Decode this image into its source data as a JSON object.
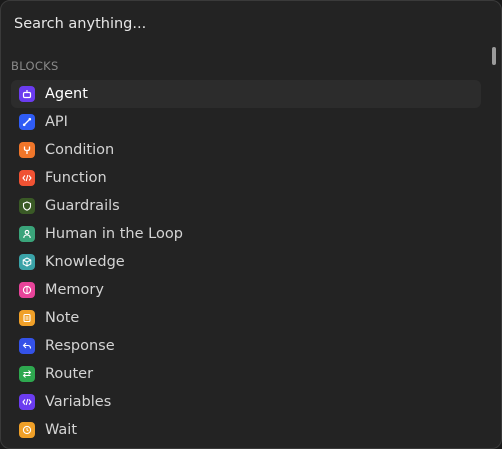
{
  "search": {
    "placeholder": "Search anything...",
    "value": ""
  },
  "section": {
    "title": "BLOCKS"
  },
  "items": [
    {
      "label": "Agent",
      "icon": "robot-icon",
      "color": "#6b3cf0",
      "active": true
    },
    {
      "label": "API",
      "icon": "link-icon",
      "color": "#2f5cf5"
    },
    {
      "label": "Condition",
      "icon": "branch-icon",
      "color": "#f0762a"
    },
    {
      "label": "Function",
      "icon": "code-icon",
      "color": "#f05233"
    },
    {
      "label": "Guardrails",
      "icon": "shield-icon",
      "color": "#3a5a26"
    },
    {
      "label": "Human in the Loop",
      "icon": "user-icon",
      "color": "#3aa47a"
    },
    {
      "label": "Knowledge",
      "icon": "cube-icon",
      "color": "#3aa3a8"
    },
    {
      "label": "Memory",
      "icon": "brain-icon",
      "color": "#e8449a"
    },
    {
      "label": "Note",
      "icon": "note-icon",
      "color": "#f0a028"
    },
    {
      "label": "Response",
      "icon": "reply-icon",
      "color": "#3452e8"
    },
    {
      "label": "Router",
      "icon": "arrows-icon",
      "color": "#2ea84f"
    },
    {
      "label": "Variables",
      "icon": "code-icon",
      "color": "#6b3cf0"
    },
    {
      "label": "Wait",
      "icon": "clock-icon",
      "color": "#f0a028"
    }
  ]
}
